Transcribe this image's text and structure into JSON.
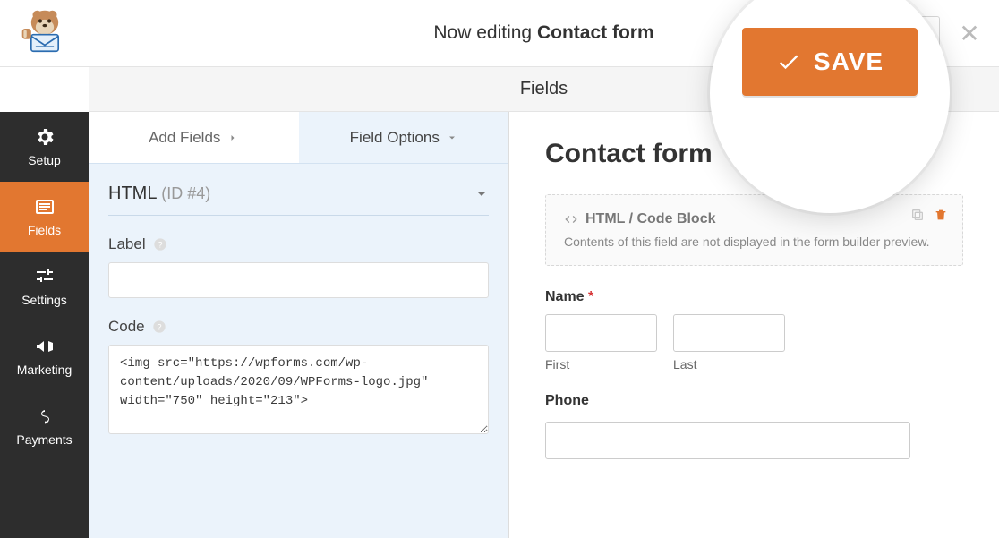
{
  "topbar": {
    "editing_prefix": "Now editing",
    "form_name": "Contact form",
    "save_label": "SAVE"
  },
  "section_header": "Fields",
  "sidebar": {
    "items": [
      {
        "label": "Setup"
      },
      {
        "label": "Fields"
      },
      {
        "label": "Settings"
      },
      {
        "label": "Marketing"
      },
      {
        "label": "Payments"
      }
    ]
  },
  "panel": {
    "tabs": {
      "add": "Add Fields",
      "options": "Field Options"
    },
    "heading_type": "HTML",
    "heading_id": "(ID #4)",
    "label_field_label": "Label",
    "label_value": "",
    "code_field_label": "Code",
    "code_value": "<img src=\"https://wpforms.com/wp-content/uploads/2020/09/WPForms-logo.jpg\" width=\"750\" height=\"213\">"
  },
  "preview": {
    "title": "Contact form",
    "html_block_title": "HTML / Code Block",
    "html_block_desc": "Contents of this field are not displayed in the form builder preview.",
    "name_label": "Name",
    "first_label": "First",
    "last_label": "Last",
    "phone_label": "Phone"
  }
}
